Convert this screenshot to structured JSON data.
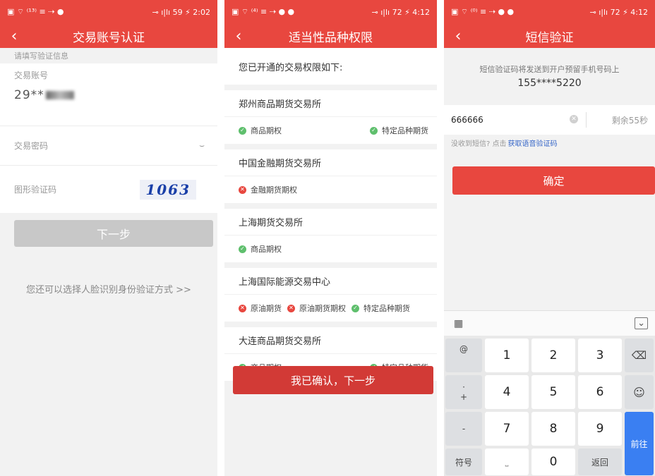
{
  "panel1": {
    "status": {
      "left": "▣ ⌔ ⁽¹³⁾ ≡ ⇢ ●",
      "right": "⊸ ı|lı 59 ⚡ 2:02"
    },
    "title": "交易账号认证",
    "hint": "请填写验证信息",
    "account_label": "交易账号",
    "account_value": "29**",
    "password_label": "交易密码",
    "captcha_label": "图形验证码",
    "captcha_value": "1063",
    "next_button": "下一步",
    "face_link": "您还可以选择人脸识别身份验证方式 >>"
  },
  "panel2": {
    "status": {
      "left": "▣ ⌔ ⁽⁴⁾ ≡ ⇢ ● ●",
      "right": "⊸ ı|lı 72 ⚡ 4:12"
    },
    "title": "适当性品种权限",
    "intro": "您已开通的交易权限如下:",
    "exchanges": [
      {
        "name": "郑州商品期货交易所",
        "items": [
          {
            "label": "商品期权",
            "ok": true
          },
          {
            "label": "特定品种期货",
            "ok": true
          }
        ]
      },
      {
        "name": "中国金融期货交易所",
        "items": [
          {
            "label": "金融期货期权",
            "ok": false
          }
        ]
      },
      {
        "name": "上海期货交易所",
        "items": [
          {
            "label": "商品期权",
            "ok": true
          }
        ]
      },
      {
        "name": "上海国际能源交易中心",
        "items": [
          {
            "label": "原油期货",
            "ok": false
          },
          {
            "label": "原油期货期权",
            "ok": false
          },
          {
            "label": "特定品种期货",
            "ok": true
          }
        ]
      },
      {
        "name": "大连商品期货交易所",
        "items": [
          {
            "label": "商品期权",
            "ok": true
          },
          {
            "label": "特定品种期货",
            "ok": true
          }
        ]
      }
    ],
    "confirm_button": "我已确认，下一步"
  },
  "panel3": {
    "status": {
      "left": "▣ ⌔ ⁽⁰⁾ ≡ ⇢ ● ●",
      "right": "⊸ ı|lı 72 ⚡ 4:12"
    },
    "title": "短信验证",
    "sms_info": "短信验证码将发送到开户预留手机号码上",
    "phone": "155****5220",
    "code_value": "666666",
    "countdown": "剩余55秒",
    "voice_prefix": "没收到短信? 点击",
    "voice_link": "获取语音验证码",
    "ok_button": "确定",
    "keyboard": {
      "digits": [
        "1",
        "2",
        "3",
        "4",
        "5",
        "6",
        "7",
        "8",
        "9",
        "0"
      ],
      "side_keys": [
        "@",
        "·",
        "+",
        "-"
      ],
      "symbol_key": "符号",
      "return_key": "返回",
      "go_key": "前往"
    }
  }
}
